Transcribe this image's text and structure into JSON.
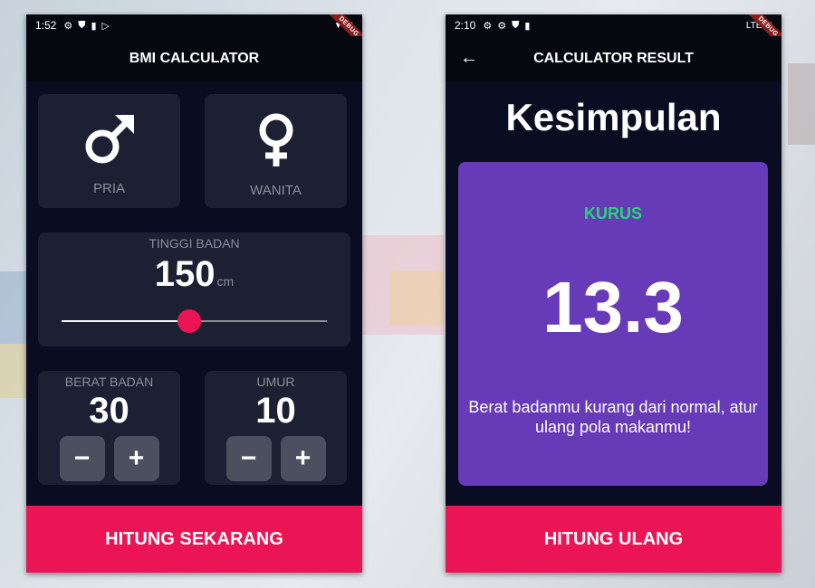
{
  "left_screen": {
    "status_bar": {
      "time": "1:52",
      "debug": "DEBUG"
    },
    "app_bar": {
      "title": "BMI CALCULATOR"
    },
    "gender": {
      "male_label": "PRIA",
      "female_label": "WANITA",
      "male_icon": "mars-icon",
      "female_icon": "venus-icon"
    },
    "height": {
      "label": "TINGGI BADAN",
      "value": "150",
      "unit": "cm",
      "slider_fraction": 0.48
    },
    "weight": {
      "label": "BERAT BADAN",
      "value": "30"
    },
    "age": {
      "label": "UMUR",
      "value": "10"
    },
    "buttons": {
      "minus": "−",
      "plus": "+"
    },
    "calculate_button": "HITUNG SEKARANG"
  },
  "right_screen": {
    "status_bar": {
      "time": "2:10",
      "network": "LTE",
      "debug": "DEBUG"
    },
    "app_bar": {
      "title": "CALCULATOR RESULT",
      "back_icon": "back-arrow-icon"
    },
    "title": "Kesimpulan",
    "result": {
      "status": "KURUS",
      "value": "13.3",
      "message": "Berat badanmu kurang dari normal, atur ulang pola makanmu!"
    },
    "recalculate_button": "HITUNG ULANG"
  },
  "colors": {
    "background": "#0a0d22",
    "card": "#1d1f33",
    "accent": "#eb1555",
    "result_card": "#673ab7",
    "status_underweight": "#24d876"
  }
}
